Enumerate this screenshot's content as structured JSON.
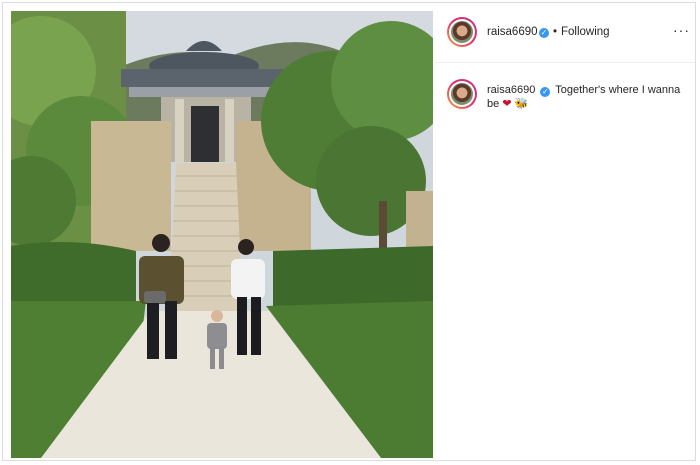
{
  "post": {
    "username": "raisa6690",
    "follow_status": "Following",
    "separator": "•",
    "more_label": "···",
    "caption_username": "raisa6690",
    "caption_text": "Together's where I wanna be",
    "caption_emoji_1": "❤",
    "caption_emoji_2": "🐝",
    "icons": [
      "verified-badge-icon",
      "more-options-icon",
      "heart-emoji",
      "bee-emoji"
    ],
    "colors": {
      "verified": "#3897f0",
      "heart": "#d10f2a",
      "text": "#262626"
    }
  }
}
